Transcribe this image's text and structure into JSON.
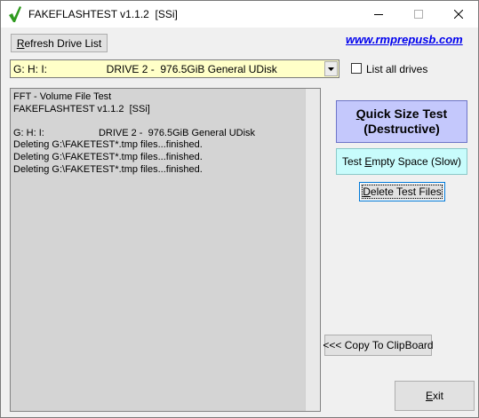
{
  "window": {
    "title": "FAKEFLASHTEST v1.1.2  [SSi]",
    "minimize_glyph": "—",
    "maximize_glyph": "☐",
    "close_glyph": "✕"
  },
  "toolbar": {
    "refresh_label_first": "R",
    "refresh_label_rest": "efresh Drive List",
    "website_link": "www.rmprepusb.com"
  },
  "drive_select": {
    "selected_value": "G: H: I:                    DRIVE 2 -  976.5GiB General UDisk",
    "arrow_icon": "chevron-down-icon"
  },
  "list_all_drives": {
    "label": "List all drives",
    "checked": false
  },
  "log": {
    "lines": [
      "FFT - Volume File Test",
      "FAKEFLASHTEST v1.1.2  [SSi]",
      "",
      "G: H: I:                    DRIVE 2 -  976.5GiB General UDisk",
      "Deleting G:\\FAKETEST*.tmp files...finished.",
      "Deleting G:\\FAKETEST*.tmp files...finished.",
      "Deleting G:\\FAKETEST*.tmp files...finished."
    ]
  },
  "buttons": {
    "quick_size_line1_first": "Q",
    "quick_size_line1_rest": "uick Size Test",
    "quick_size_line2": "(Destructive)",
    "test_empty_prefix": "Test ",
    "test_empty_u": "E",
    "test_empty_rest": "mpty Space (Slow)",
    "delete_first": "D",
    "delete_rest": "elete Test Files",
    "copy_label": "<<< Copy To ClipBoard",
    "exit_first": "E",
    "exit_rest": "xit"
  },
  "colors": {
    "quick_size_bg": "#c4c8fc",
    "test_empty_bg": "#c8fcfc",
    "combo_bg": "#ffffc8",
    "log_bg": "#d4d4d4",
    "checkmark_green": "#2e9a1e"
  }
}
